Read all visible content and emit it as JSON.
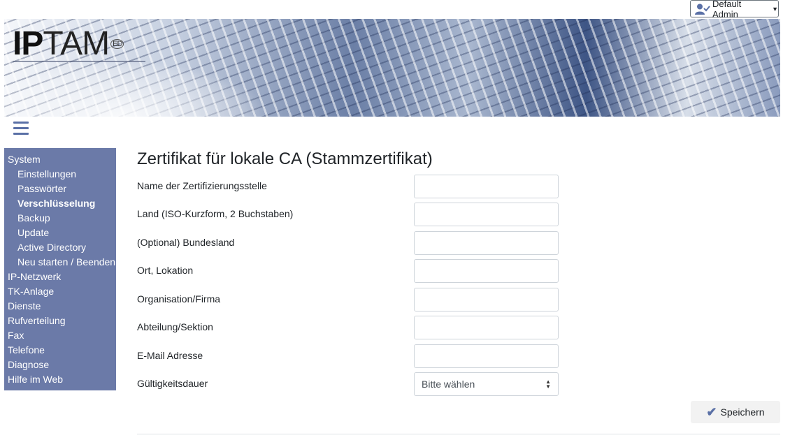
{
  "user_menu": {
    "label": "Default Admin"
  },
  "logo": {
    "ip": "IP",
    "tam": "TAM",
    "mark": "ED"
  },
  "sidebar": {
    "items": [
      {
        "label": "System"
      },
      {
        "label": "Einstellungen"
      },
      {
        "label": "Passwörter"
      },
      {
        "label": "Verschlüsselung"
      },
      {
        "label": "Backup"
      },
      {
        "label": "Update"
      },
      {
        "label": "Active Directory"
      },
      {
        "label": "Neu starten / Beenden"
      },
      {
        "label": "IP-Netzwerk"
      },
      {
        "label": "TK-Anlage"
      },
      {
        "label": "Dienste"
      },
      {
        "label": "Rufverteilung"
      },
      {
        "label": "Fax"
      },
      {
        "label": "Telefone"
      },
      {
        "label": "Diagnose"
      },
      {
        "label": "Hilfe im Web"
      }
    ]
  },
  "main": {
    "title": "Zertifikat für lokale CA (Stammzertifikat)",
    "fields": [
      {
        "label": "Name der Zertifizierungsstelle",
        "value": ""
      },
      {
        "label": "Land (ISO-Kurzform, 2 Buchstaben)",
        "value": ""
      },
      {
        "label": "(Optional) Bundesland",
        "value": ""
      },
      {
        "label": "Ort, Lokation",
        "value": ""
      },
      {
        "label": "Organisation/Firma",
        "value": ""
      },
      {
        "label": "Abteilung/Sektion",
        "value": ""
      },
      {
        "label": "E-Mail Adresse",
        "value": ""
      }
    ],
    "validity": {
      "label": "Gültigkeitsdauer",
      "selected": "Bitte wählen"
    },
    "save_label": "Speichern"
  },
  "colors": {
    "sidebar": "#6b7aa8",
    "accent": "#5a70a6"
  }
}
